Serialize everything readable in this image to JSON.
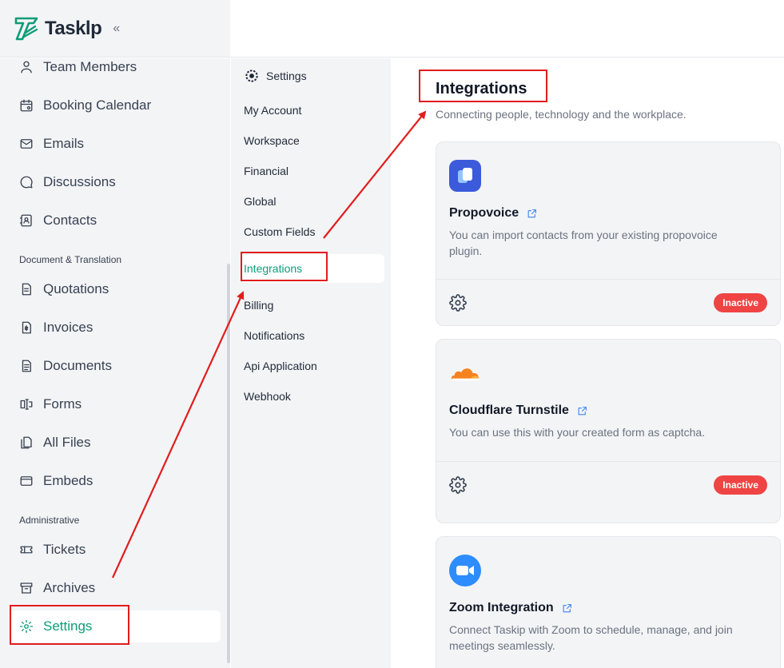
{
  "app": {
    "name": "Tasklp",
    "collapse_glyph": "«"
  },
  "sidebar": {
    "items": [
      {
        "label": "Team Members",
        "icon": "user-icon"
      },
      {
        "label": "Booking Calendar",
        "icon": "calendar-icon"
      },
      {
        "label": "Emails",
        "icon": "mail-icon"
      },
      {
        "label": "Discussions",
        "icon": "chat-icon"
      },
      {
        "label": "Contacts",
        "icon": "contacts-icon"
      },
      {
        "label": "Quotations",
        "icon": "quotation-icon"
      },
      {
        "label": "Invoices",
        "icon": "invoice-icon"
      },
      {
        "label": "Documents",
        "icon": "document-icon"
      },
      {
        "label": "Forms",
        "icon": "form-icon"
      },
      {
        "label": "All Files",
        "icon": "files-icon"
      },
      {
        "label": "Embeds",
        "icon": "embed-icon"
      },
      {
        "label": "Tickets",
        "icon": "ticket-icon"
      },
      {
        "label": "Archives",
        "icon": "archive-icon"
      },
      {
        "label": "Settings",
        "icon": "gear-icon",
        "active": true
      }
    ],
    "sections": {
      "document_translation": "Document & Translation",
      "administrative": "Administrative"
    }
  },
  "settings_nav": {
    "title": "Settings",
    "items": [
      {
        "label": "My Account"
      },
      {
        "label": "Workspace"
      },
      {
        "label": "Financial"
      },
      {
        "label": "Global"
      },
      {
        "label": "Custom Fields"
      },
      {
        "label": "Integrations",
        "active": true
      },
      {
        "label": "Billing"
      },
      {
        "label": "Notifications"
      },
      {
        "label": "Api Application"
      },
      {
        "label": "Webhook"
      }
    ]
  },
  "main": {
    "title": "Integrations",
    "subtitle": "Connecting people, technology and the workplace.",
    "cards": [
      {
        "name": "Propovoice",
        "description": "You can import contacts from your existing propovoice plugin.",
        "status": "Inactive",
        "icon": "propovoice-icon"
      },
      {
        "name": "Cloudflare Turnstile",
        "description": "You can use this with your created form as captcha.",
        "status": "Inactive",
        "icon": "cloudflare-icon"
      },
      {
        "name": "Zoom Integration",
        "description": "Connect Taskip with Zoom to schedule, manage, and join meetings seamlessly.",
        "icon": "zoom-icon"
      }
    ]
  },
  "colors": {
    "accent": "#0f9d78",
    "inactive_badge": "#ef4444",
    "annotation": "#e11d1d",
    "sidebar_bg": "#f3f4f6"
  }
}
